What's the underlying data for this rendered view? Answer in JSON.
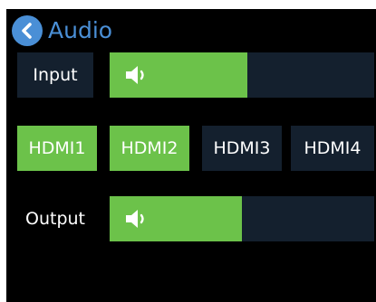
{
  "header": {
    "title": "Audio",
    "back_icon": "chevron-left-icon"
  },
  "input": {
    "label": "Input",
    "volume_fraction": 0.52,
    "icon": "speaker-icon"
  },
  "sources": [
    {
      "label": "HDMI1",
      "active": true
    },
    {
      "label": "HDMI2",
      "active": true
    },
    {
      "label": "HDMI3",
      "active": false
    },
    {
      "label": "HDMI4",
      "active": false
    }
  ],
  "output": {
    "label": "Output",
    "volume_fraction": 0.5,
    "icon": "speaker-icon"
  },
  "colors": {
    "accent": "#4a8fd6",
    "active": "#6cc24a",
    "inactive": "#14202e",
    "background": "#000000"
  }
}
